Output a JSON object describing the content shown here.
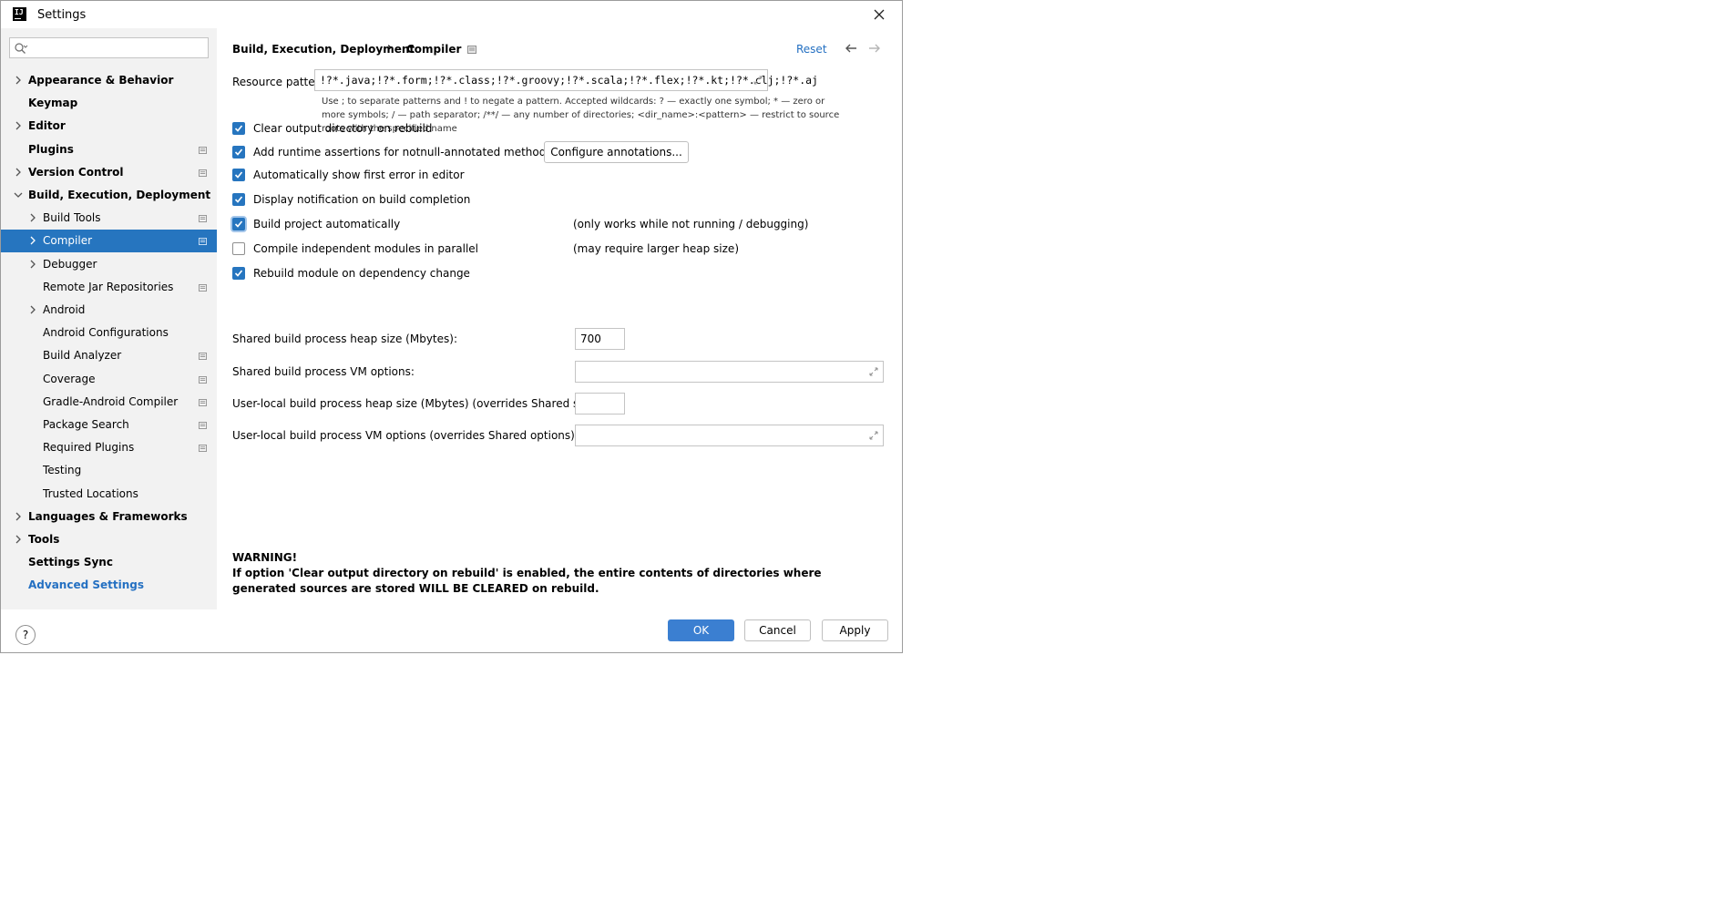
{
  "window": {
    "title": "Settings"
  },
  "icons": {
    "app": "intellij-logo-icon",
    "close": "close-icon",
    "search": "search-icon",
    "chevron_right": "chevron-right-icon",
    "chevron_down": "chevron-down-icon",
    "project_level": "project-level-icon",
    "back": "arrow-left-icon",
    "forward": "arrow-right-icon",
    "expand": "expand-icon",
    "help": "help-icon"
  },
  "colors": {
    "accent": "#2675bf",
    "link": "#2470c2",
    "sidebar_bg": "#f2f2f2"
  },
  "sidebar": {
    "search": {
      "value": "",
      "placeholder": ""
    },
    "items": [
      {
        "label": "Appearance & Behavior",
        "level": 0,
        "bold": true,
        "expandable": true,
        "expanded": false,
        "marker": false
      },
      {
        "label": "Keymap",
        "level": 0,
        "bold": true,
        "expandable": false,
        "marker": false
      },
      {
        "label": "Editor",
        "level": 0,
        "bold": true,
        "expandable": true,
        "expanded": false,
        "marker": false
      },
      {
        "label": "Plugins",
        "level": 0,
        "bold": true,
        "expandable": false,
        "marker": true
      },
      {
        "label": "Version Control",
        "level": 0,
        "bold": true,
        "expandable": true,
        "expanded": false,
        "marker": true
      },
      {
        "label": "Build, Execution, Deployment",
        "level": 0,
        "bold": true,
        "expandable": true,
        "expanded": true,
        "marker": false
      },
      {
        "label": "Build Tools",
        "level": 1,
        "bold": false,
        "expandable": true,
        "expanded": false,
        "marker": true
      },
      {
        "label": "Compiler",
        "level": 1,
        "bold": false,
        "expandable": true,
        "expanded": false,
        "marker": true,
        "selected": true
      },
      {
        "label": "Debugger",
        "level": 1,
        "bold": false,
        "expandable": true,
        "expanded": false,
        "marker": false
      },
      {
        "label": "Remote Jar Repositories",
        "level": 1,
        "bold": false,
        "expandable": false,
        "marker": true
      },
      {
        "label": "Android",
        "level": 1,
        "bold": false,
        "expandable": true,
        "expanded": false,
        "marker": false
      },
      {
        "label": "Android Configurations",
        "level": 1,
        "bold": false,
        "expandable": false,
        "marker": false
      },
      {
        "label": "Build Analyzer",
        "level": 1,
        "bold": false,
        "expandable": false,
        "marker": true
      },
      {
        "label": "Coverage",
        "level": 1,
        "bold": false,
        "expandable": false,
        "marker": true
      },
      {
        "label": "Gradle-Android Compiler",
        "level": 1,
        "bold": false,
        "expandable": false,
        "marker": true
      },
      {
        "label": "Package Search",
        "level": 1,
        "bold": false,
        "expandable": false,
        "marker": true
      },
      {
        "label": "Required Plugins",
        "level": 1,
        "bold": false,
        "expandable": false,
        "marker": true
      },
      {
        "label": "Testing",
        "level": 1,
        "bold": false,
        "expandable": false,
        "marker": false
      },
      {
        "label": "Trusted Locations",
        "level": 1,
        "bold": false,
        "expandable": false,
        "marker": false
      },
      {
        "label": "Languages & Frameworks",
        "level": 0,
        "bold": true,
        "expandable": true,
        "expanded": false,
        "marker": false
      },
      {
        "label": "Tools",
        "level": 0,
        "bold": true,
        "expandable": true,
        "expanded": false,
        "marker": false
      },
      {
        "label": "Settings Sync",
        "level": 0,
        "bold": true,
        "expandable": false,
        "marker": false
      },
      {
        "label": "Advanced Settings",
        "level": 0,
        "bold": true,
        "expandable": false,
        "marker": false,
        "link": true
      }
    ]
  },
  "header": {
    "breadcrumb": [
      "Build, Execution, Deployment",
      "Compiler"
    ],
    "separator": "›",
    "reset_label": "Reset"
  },
  "form": {
    "resource_patterns_label": "Resource patterns:",
    "resource_patterns_value": "!?*.java;!?*.form;!?*.class;!?*.groovy;!?*.scala;!?*.flex;!?*.kt;!?*.clj;!?*.aj",
    "hint_lines": [
      "Use ; to separate patterns and ! to negate a pattern. Accepted wildcards: ? — exactly one symbol; * — zero or",
      "more symbols; / — path separator; /**/ — any number of directories; <dir_name>:<pattern> — restrict to source",
      "roots with the specified name"
    ],
    "checkboxes": [
      {
        "label": "Clear output directory on rebuild",
        "checked": true
      },
      {
        "label": "Add runtime assertions for notnull-annotated methods and parameters",
        "checked": true
      },
      {
        "label": "Automatically show first error in editor",
        "checked": true
      },
      {
        "label": "Display notification on build completion",
        "checked": true
      },
      {
        "label": "Build project automatically",
        "checked": true,
        "note": "(only works while not running / debugging)"
      },
      {
        "label": "Compile independent modules in parallel",
        "checked": false,
        "note": "(may require larger heap size)"
      },
      {
        "label": "Rebuild module on dependency change",
        "checked": true
      }
    ],
    "configure_annotations_label": "Configure annotations...",
    "heap_label": "Shared build process heap size (Mbytes):",
    "heap_value": "700",
    "vm_label": "Shared build process VM options:",
    "vm_value": "",
    "local_heap_label": "User-local build process heap size (Mbytes) (overrides Shared size):",
    "local_heap_value": "",
    "local_vm_label": "User-local build process VM options (overrides Shared options):",
    "local_vm_value": ""
  },
  "warning": {
    "title": "WARNING!",
    "text": "If option 'Clear output directory on rebuild' is enabled, the entire contents of directories where generated sources are stored WILL BE CLEARED on rebuild."
  },
  "footer": {
    "help": "?",
    "ok": "OK",
    "cancel": "Cancel",
    "apply": "Apply"
  }
}
